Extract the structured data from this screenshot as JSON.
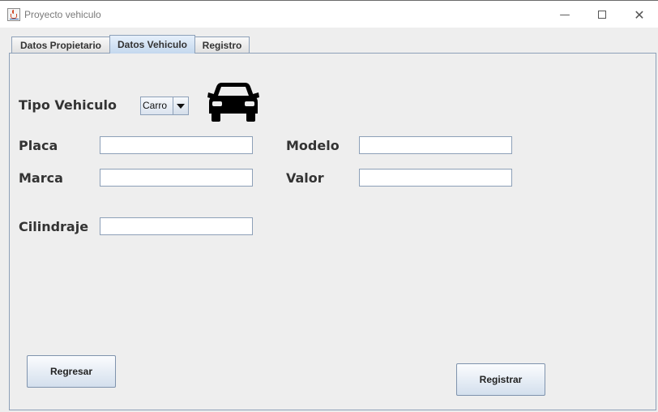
{
  "window": {
    "title": "Proyecto vehiculo"
  },
  "tabs": [
    {
      "label": "Datos Propietario",
      "selected": false
    },
    {
      "label": "Datos Vehiculo",
      "selected": true
    },
    {
      "label": "Registro",
      "selected": false
    }
  ],
  "form": {
    "tipo_label": "Tipo Vehiculo",
    "tipo_selected": "Carro",
    "tipo_icon": "car-icon",
    "placa_label": "Placa",
    "placa_value": "",
    "modelo_label": "Modelo",
    "modelo_value": "",
    "marca_label": "Marca",
    "marca_value": "",
    "valor_label": "Valor",
    "valor_value": "",
    "cilindraje_label": "Cilindraje",
    "cilindraje_value": ""
  },
  "buttons": {
    "regresar": "Regresar",
    "registrar": "Registrar"
  },
  "colors": {
    "panel_background": "#eeeeee",
    "selected_tab": "#c4d8ee",
    "border": "#8da0b8"
  }
}
